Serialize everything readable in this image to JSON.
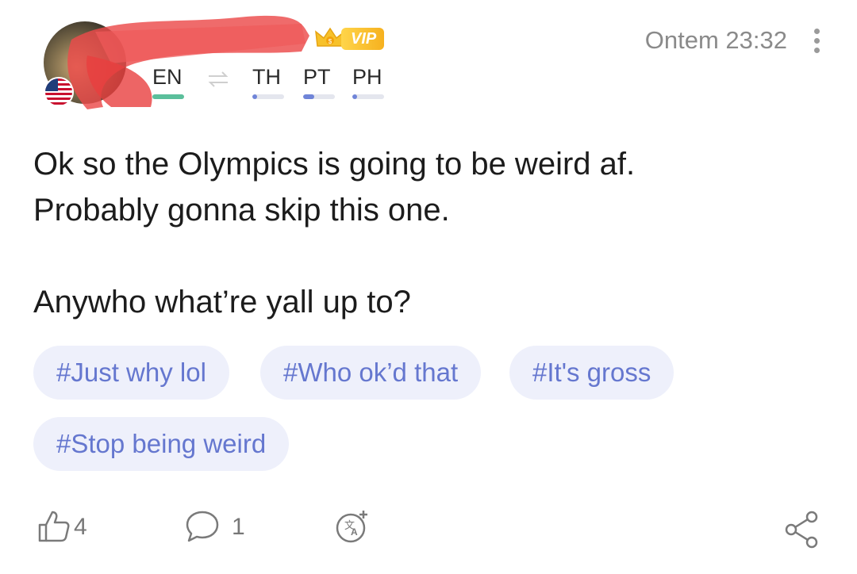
{
  "header": {
    "vip_label": "VIP",
    "timestamp": "Ontem 23:32",
    "native_language": "EN",
    "learning_languages": [
      {
        "code": "TH",
        "level": 0.15
      },
      {
        "code": "PT",
        "level": 0.35
      },
      {
        "code": "PH",
        "level": 0.15
      }
    ]
  },
  "post": {
    "lines": [
      "Ok so the Olympics is going to be weird af.",
      "Probably gonna skip this one.",
      "Anywho what’re yall up to?"
    ]
  },
  "hashtags": [
    "#Just why lol",
    "#Who ok’d that",
    "#It's gross",
    "#Stop being weird"
  ],
  "actions": {
    "likes": "4",
    "comments": "1"
  },
  "colors": {
    "accent": "#6577cf",
    "tag_bg": "#eef0fb",
    "native_bar": "#5bbf9b",
    "vip_gold": "#f6b11f"
  }
}
